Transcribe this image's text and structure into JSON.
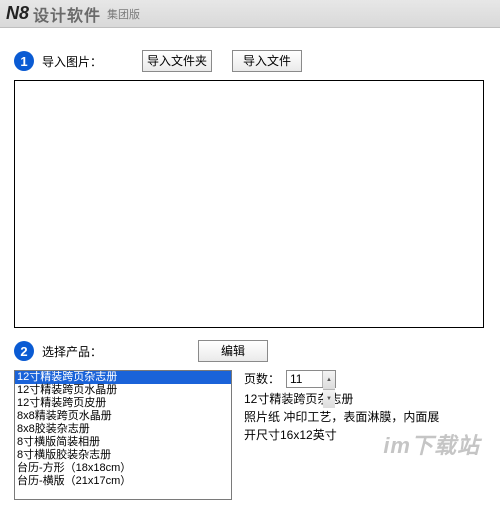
{
  "titlebar": {
    "logo": "N8",
    "title_main": "设计软件",
    "title_sub": "集团版"
  },
  "step1": {
    "number": "1",
    "label": "导入图片：",
    "import_folder_btn": "导入文件夹",
    "import_file_btn": "导入文件"
  },
  "step2": {
    "number": "2",
    "label": "选择产品：",
    "edit_btn": "编辑"
  },
  "products": {
    "items": [
      "12寸精装跨页杂志册",
      "12寸精装跨页水晶册",
      "12寸精装跨页皮册",
      "8x8精装跨页水晶册",
      "8x8胶装杂志册",
      "8寸横版简装相册",
      "8寸横版胶装杂志册",
      "台历-方形（18x18cm）",
      "台历-横版（21x17cm）"
    ],
    "selected_index": 0
  },
  "detail": {
    "pages_label": "页数：",
    "pages_value": "11",
    "line1": "12寸精装跨页杂志册",
    "line2": "照片纸 冲印工艺，表面淋膜，内面展",
    "line3": "开尺寸16x12英寸"
  },
  "watermark": "im下载站"
}
